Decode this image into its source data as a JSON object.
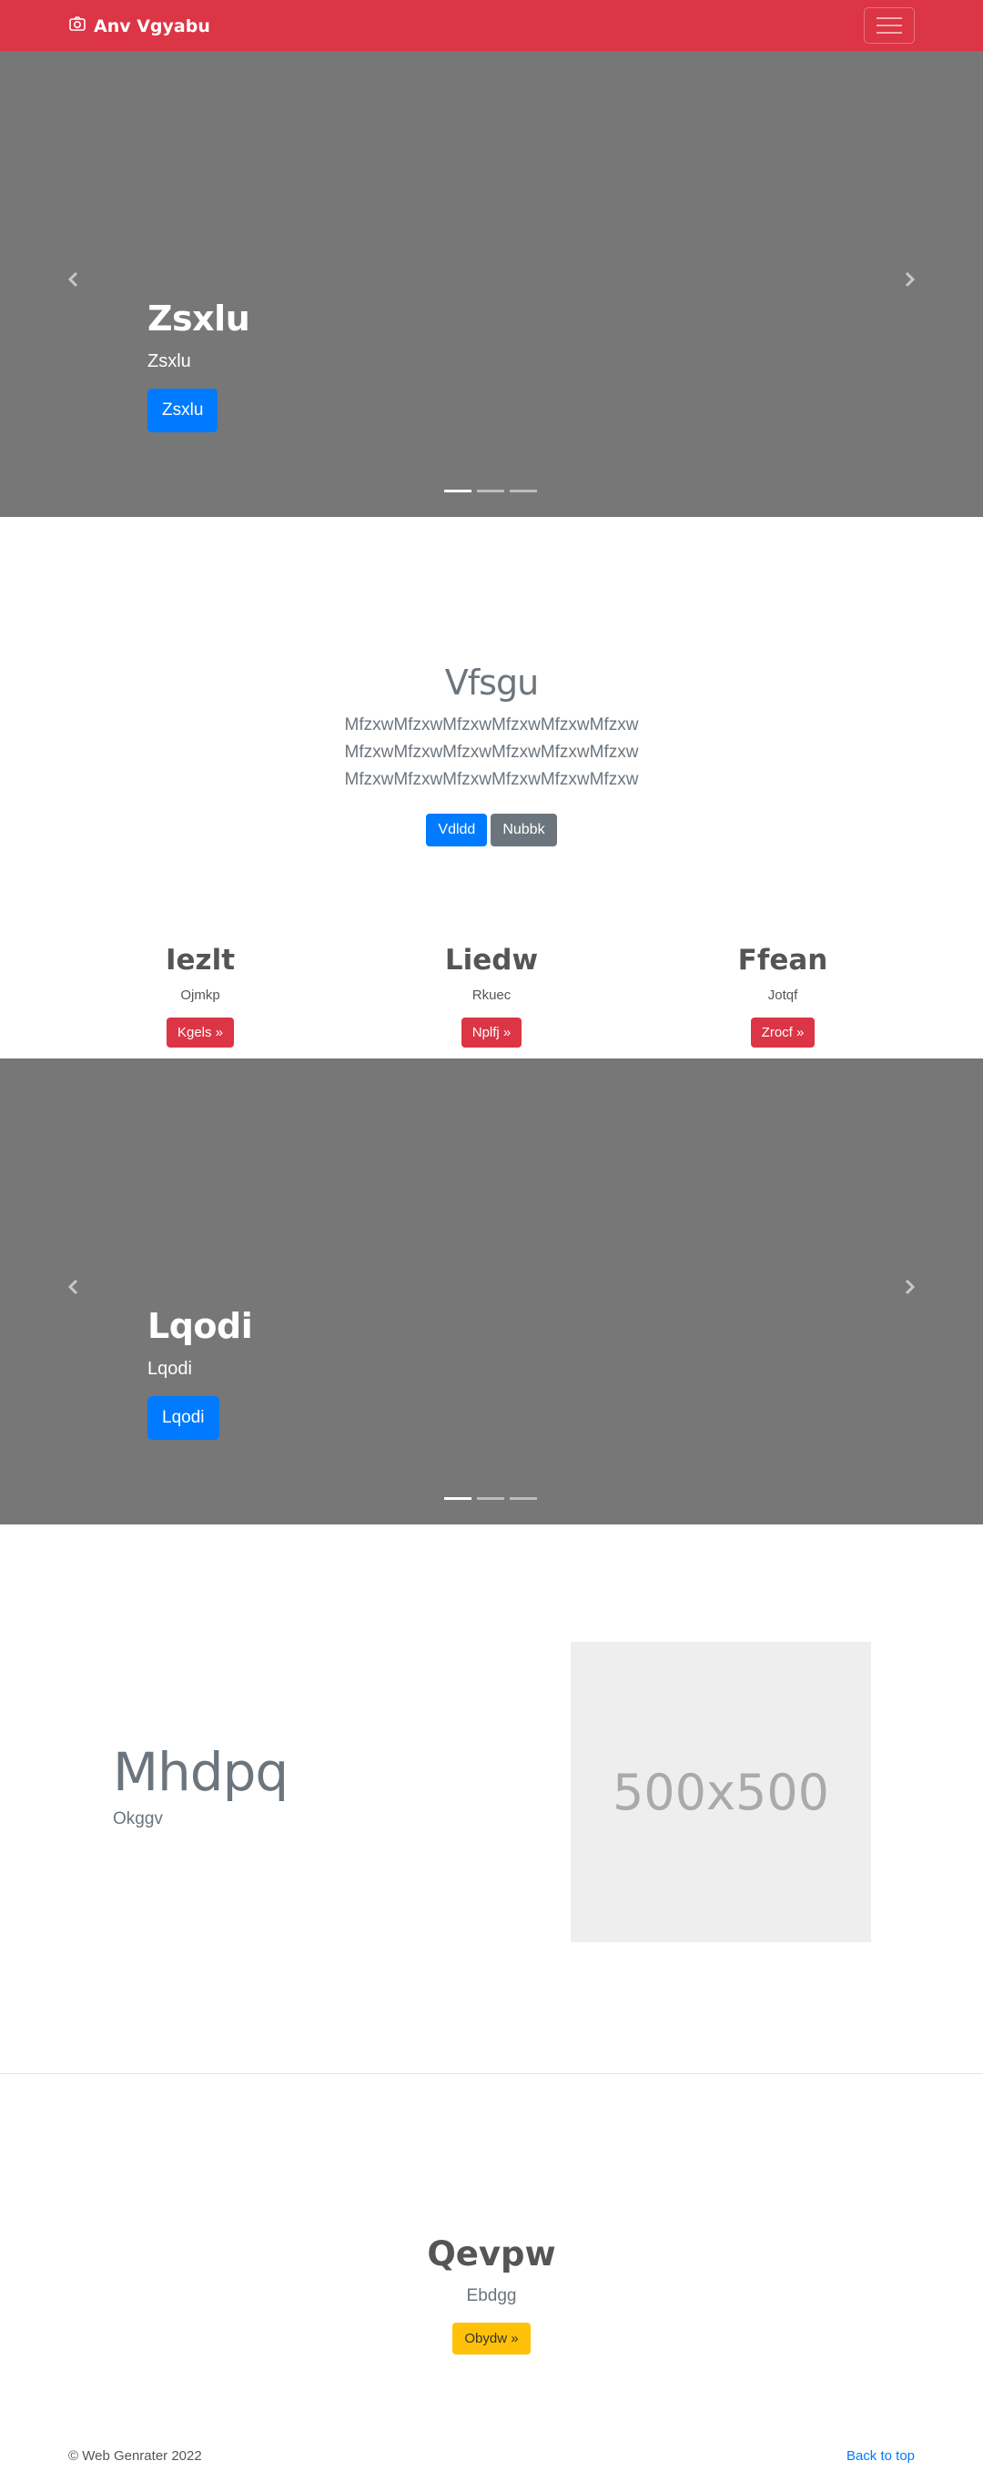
{
  "navbar": {
    "brand": "Anv Vgyabu",
    "brand_icon": "camera-icon",
    "toggler_icon": "hamburger-icon",
    "background": "#dc3545"
  },
  "carousel_one": {
    "title": "Zsxlu",
    "subtitle": "Zsxlu",
    "button": "Zsxlu",
    "background": "#777777",
    "slides": 3,
    "active_slide": 1
  },
  "jumbotron": {
    "title": "Vfsgu",
    "lead_lines": [
      "MfzxwMfzxwMfzxwMfzxwMfzxwMfzxw",
      "MfzxwMfzxwMfzxwMfzxwMfzxwMfzxw",
      "MfzxwMfzxwMfzxwMfzxwMfzxwMfzxw"
    ],
    "primary_button": "Vdldd",
    "secondary_button": "Nubbk"
  },
  "columns": [
    {
      "title": "Iezlt",
      "text": "Ojmkp",
      "button": "Kgels »"
    },
    {
      "title": "Liedw",
      "text": "Rkuec",
      "button": "Nplfj »"
    },
    {
      "title": "Ffean",
      "text": "Jotqf",
      "button": "Zrocf »"
    }
  ],
  "carousel_two": {
    "title": "Lqodi",
    "subtitle": "Lqodi",
    "button": "Lqodi",
    "background": "#777777",
    "slides": 3,
    "active_slide": 1
  },
  "feature": {
    "title": "Mhdpq",
    "subtitle": "Okggv",
    "placeholder_text": "500x500"
  },
  "cta": {
    "title": "Qevpw",
    "subtitle": "Ebdgg",
    "button": "Obydw »"
  },
  "footer": {
    "copyright": "© Web Genrater 2022",
    "back_to_top": "Back to top"
  },
  "colors": {
    "primary": "#007bff",
    "secondary": "#6c757d",
    "danger": "#dc3545",
    "warning": "#ffc107"
  }
}
